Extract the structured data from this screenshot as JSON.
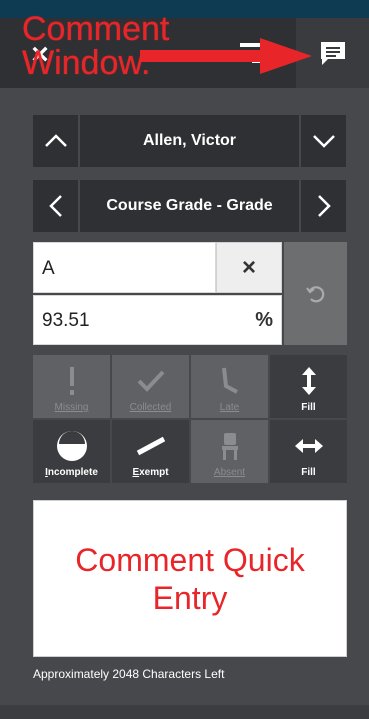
{
  "header": {
    "close_label": "×",
    "icons": {
      "close": "close-icon",
      "menu": "menu-icon",
      "comment": "comment-icon"
    }
  },
  "annotations": {
    "top": "Comment Window.",
    "box": "Comment Quick Entry",
    "color": "#e8262a"
  },
  "student_nav": {
    "name": "Allen, Victor"
  },
  "assignment_nav": {
    "name": "Course Grade - Grade"
  },
  "grade": {
    "letter": "A",
    "clear_label": "×",
    "percent_value": "93.51",
    "percent_unit": "%"
  },
  "status_buttons": [
    {
      "label": "Missing",
      "icon": "exclamation-icon",
      "active": false
    },
    {
      "label": "Collected",
      "icon": "check-icon",
      "active": false
    },
    {
      "label": "Late",
      "icon": "late-icon",
      "active": false
    },
    {
      "label": "Fill",
      "icon": "fill-vertical-icon",
      "active": true
    },
    {
      "label": "Incomplete",
      "icon": "incomplete-icon",
      "active": true
    },
    {
      "label": "Exempt",
      "icon": "exempt-icon",
      "active": true
    },
    {
      "label": "Absent",
      "icon": "chair-icon",
      "active": false
    },
    {
      "label": "Fill",
      "icon": "fill-horizontal-icon",
      "active": true
    }
  ],
  "comment": {
    "chars_left": "Approximately 2048 Characters Left"
  },
  "colors": {
    "background": "#46484b",
    "header": "#2f3033",
    "top_strip": "#0f3b52",
    "button": "#5f6164",
    "annotation_red": "#e8262a"
  }
}
